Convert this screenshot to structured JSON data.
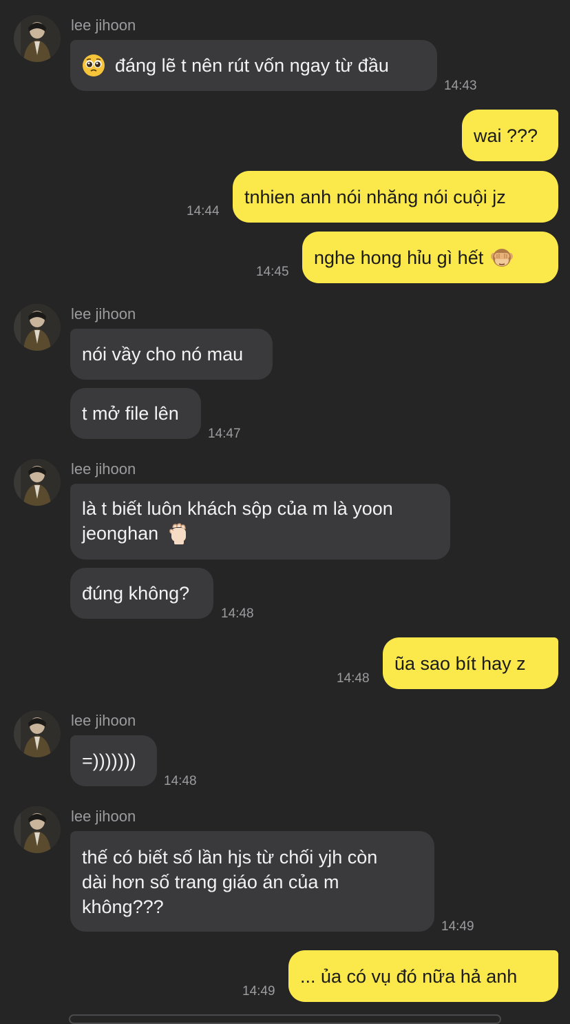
{
  "conversation": {
    "contact_name": "lee jihoon",
    "messages": [
      {
        "id": "m1",
        "sender": "lee jihoon",
        "direction": "incoming",
        "text": "đáng lẽ t nên rút vốn ngay từ đầu",
        "emoji": "pleading-face",
        "time": "14:43"
      },
      {
        "id": "m2",
        "direction": "outgoing",
        "text": "wai ???"
      },
      {
        "id": "m3",
        "direction": "outgoing",
        "text": "tnhien anh nói nhăng nói cuội jz",
        "time": "14:44"
      },
      {
        "id": "m4",
        "direction": "outgoing",
        "text": "nghe hong hỉu gì hết",
        "emoji": "see-no-evil-monkey",
        "time": "14:45"
      },
      {
        "id": "m5",
        "sender": "lee jihoon",
        "direction": "incoming",
        "text": "nói vầy cho nó mau"
      },
      {
        "id": "m6",
        "direction": "incoming",
        "text": "t mở file lên",
        "time": "14:47"
      },
      {
        "id": "m7",
        "sender": "lee jihoon",
        "direction": "incoming",
        "text_line1": "là t biết luôn khách sộp của m là yoon",
        "text_line2": "jeonghan",
        "emoji": "raised-fist"
      },
      {
        "id": "m8",
        "direction": "incoming",
        "text": "đúng không?",
        "time": "14:48"
      },
      {
        "id": "m9",
        "direction": "outgoing",
        "text": "ũa sao bít hay z",
        "time": "14:48"
      },
      {
        "id": "m10",
        "sender": "lee jihoon",
        "direction": "incoming",
        "text": "=)))))))",
        "time": "14:48"
      },
      {
        "id": "m11",
        "sender": "lee jihoon",
        "direction": "incoming",
        "text_line1": "thế có biết số lần hjs từ chối yjh còn",
        "text_line2": "dài hơn số trang giáo án của m",
        "text_line3": "không???",
        "time": "14:49"
      },
      {
        "id": "m12",
        "direction": "outgoing",
        "text": "... ủa có vụ đó nữa hả anh",
        "time": "14:49"
      }
    ]
  },
  "colors": {
    "background": "#252526",
    "incoming_bubble": "#3a3a3c",
    "outgoing_bubble": "#fbe84a",
    "muted_text": "#9c9c9e"
  }
}
